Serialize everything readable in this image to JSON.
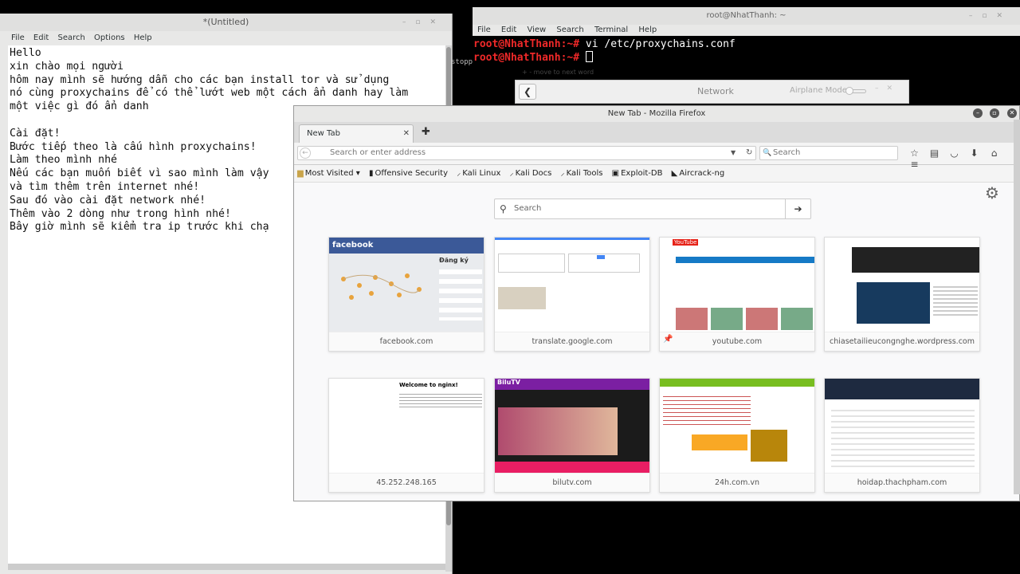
{
  "gedit": {
    "title": "*(Untitled)",
    "menu": [
      "File",
      "Edit",
      "Search",
      "Options",
      "Help"
    ],
    "lines": [
      "Hello",
      "xin chào mọi người",
      "hôm nay mình sẽ hướng dẫn cho các bạn install tor và sử dụng",
      "nó cùng proxychains để có thể lướt web một cách ẩn danh hay làm",
      "một việc gì đó ẩn danh",
      "",
      "Cài đặt!",
      "Bước tiếp theo là cấu hình proxychains!",
      "Làm theo mình nhé",
      "Nếu các bạn muốn biết vì sao mình làm vậy",
      "và tìm thêm trên internet nhé!",
      "Sau đó vào cài đặt network nhé!",
      "Thêm vào 2 dòng như trong hình nhé!",
      "Bây giờ mình sẽ kiểm tra ip trước khi chạ"
    ]
  },
  "terminal": {
    "title": "root@NhatThanh: ~",
    "menu": [
      "File",
      "Edit",
      "View",
      "Search",
      "Terminal",
      "Help"
    ],
    "prompt": "root@NhatThanh:~#",
    "command": " vi /etc/proxychains.conf",
    "partial_text": "stopp",
    "faint_text": "+ - move to next word"
  },
  "network": {
    "title": "Network",
    "airplane_mode": "Airplane Mode"
  },
  "firefox": {
    "title": "New Tab - Mozilla Firefox",
    "tab_label": "New Tab",
    "url_placeholder": "Search or enter address",
    "search_placeholder": "Search",
    "newtab_search_placeholder": "Search",
    "bookmarks": [
      {
        "label": "Most Visited ▾",
        "icon": "folder-icon"
      },
      {
        "label": "Offensive Security",
        "icon": "offsec-icon"
      },
      {
        "label": "Kali Linux",
        "icon": "kali-icon"
      },
      {
        "label": "Kali Docs",
        "icon": "kali-icon"
      },
      {
        "label": "Kali Tools",
        "icon": "kali-icon"
      },
      {
        "label": "Exploit-DB",
        "icon": "exploitdb-icon"
      },
      {
        "label": "Aircrack-ng",
        "icon": "aircrack-icon"
      }
    ],
    "tiles": [
      {
        "label": "facebook.com"
      },
      {
        "label": "translate.google.com"
      },
      {
        "label": "youtube.com"
      },
      {
        "label": "chiasetailieucongnghe.wordpress.com"
      },
      {
        "label": "45.252.248.165"
      },
      {
        "label": "bilutv.com"
      },
      {
        "label": "24h.com.vn"
      },
      {
        "label": "hoidap.thachpham.com"
      }
    ],
    "thumb_text": {
      "facebook_logo": "facebook",
      "facebook_signup": "Đăng ký",
      "nginx_heading": "Welcome to nginx!",
      "youtube_logo": "YouTube",
      "bilutv_logo": "BiluTV"
    }
  }
}
